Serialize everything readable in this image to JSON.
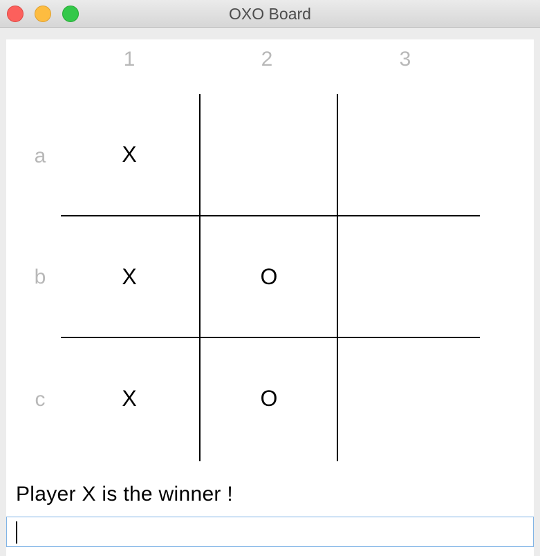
{
  "window": {
    "title": "OXO Board",
    "buttons": [
      "close",
      "minimize",
      "zoom"
    ]
  },
  "board": {
    "columns": [
      "1",
      "2",
      "3"
    ],
    "rows": [
      "a",
      "b",
      "c"
    ],
    "cells": [
      [
        "X",
        "",
        ""
      ],
      [
        "X",
        "O",
        ""
      ],
      [
        "X",
        "O",
        ""
      ]
    ]
  },
  "status": {
    "message": "Player X is the winner !"
  },
  "input": {
    "value": ""
  },
  "colors": {
    "label_gray": "#b8b8b8",
    "grid_line": "#000000",
    "input_border": "#7fb3e6"
  }
}
